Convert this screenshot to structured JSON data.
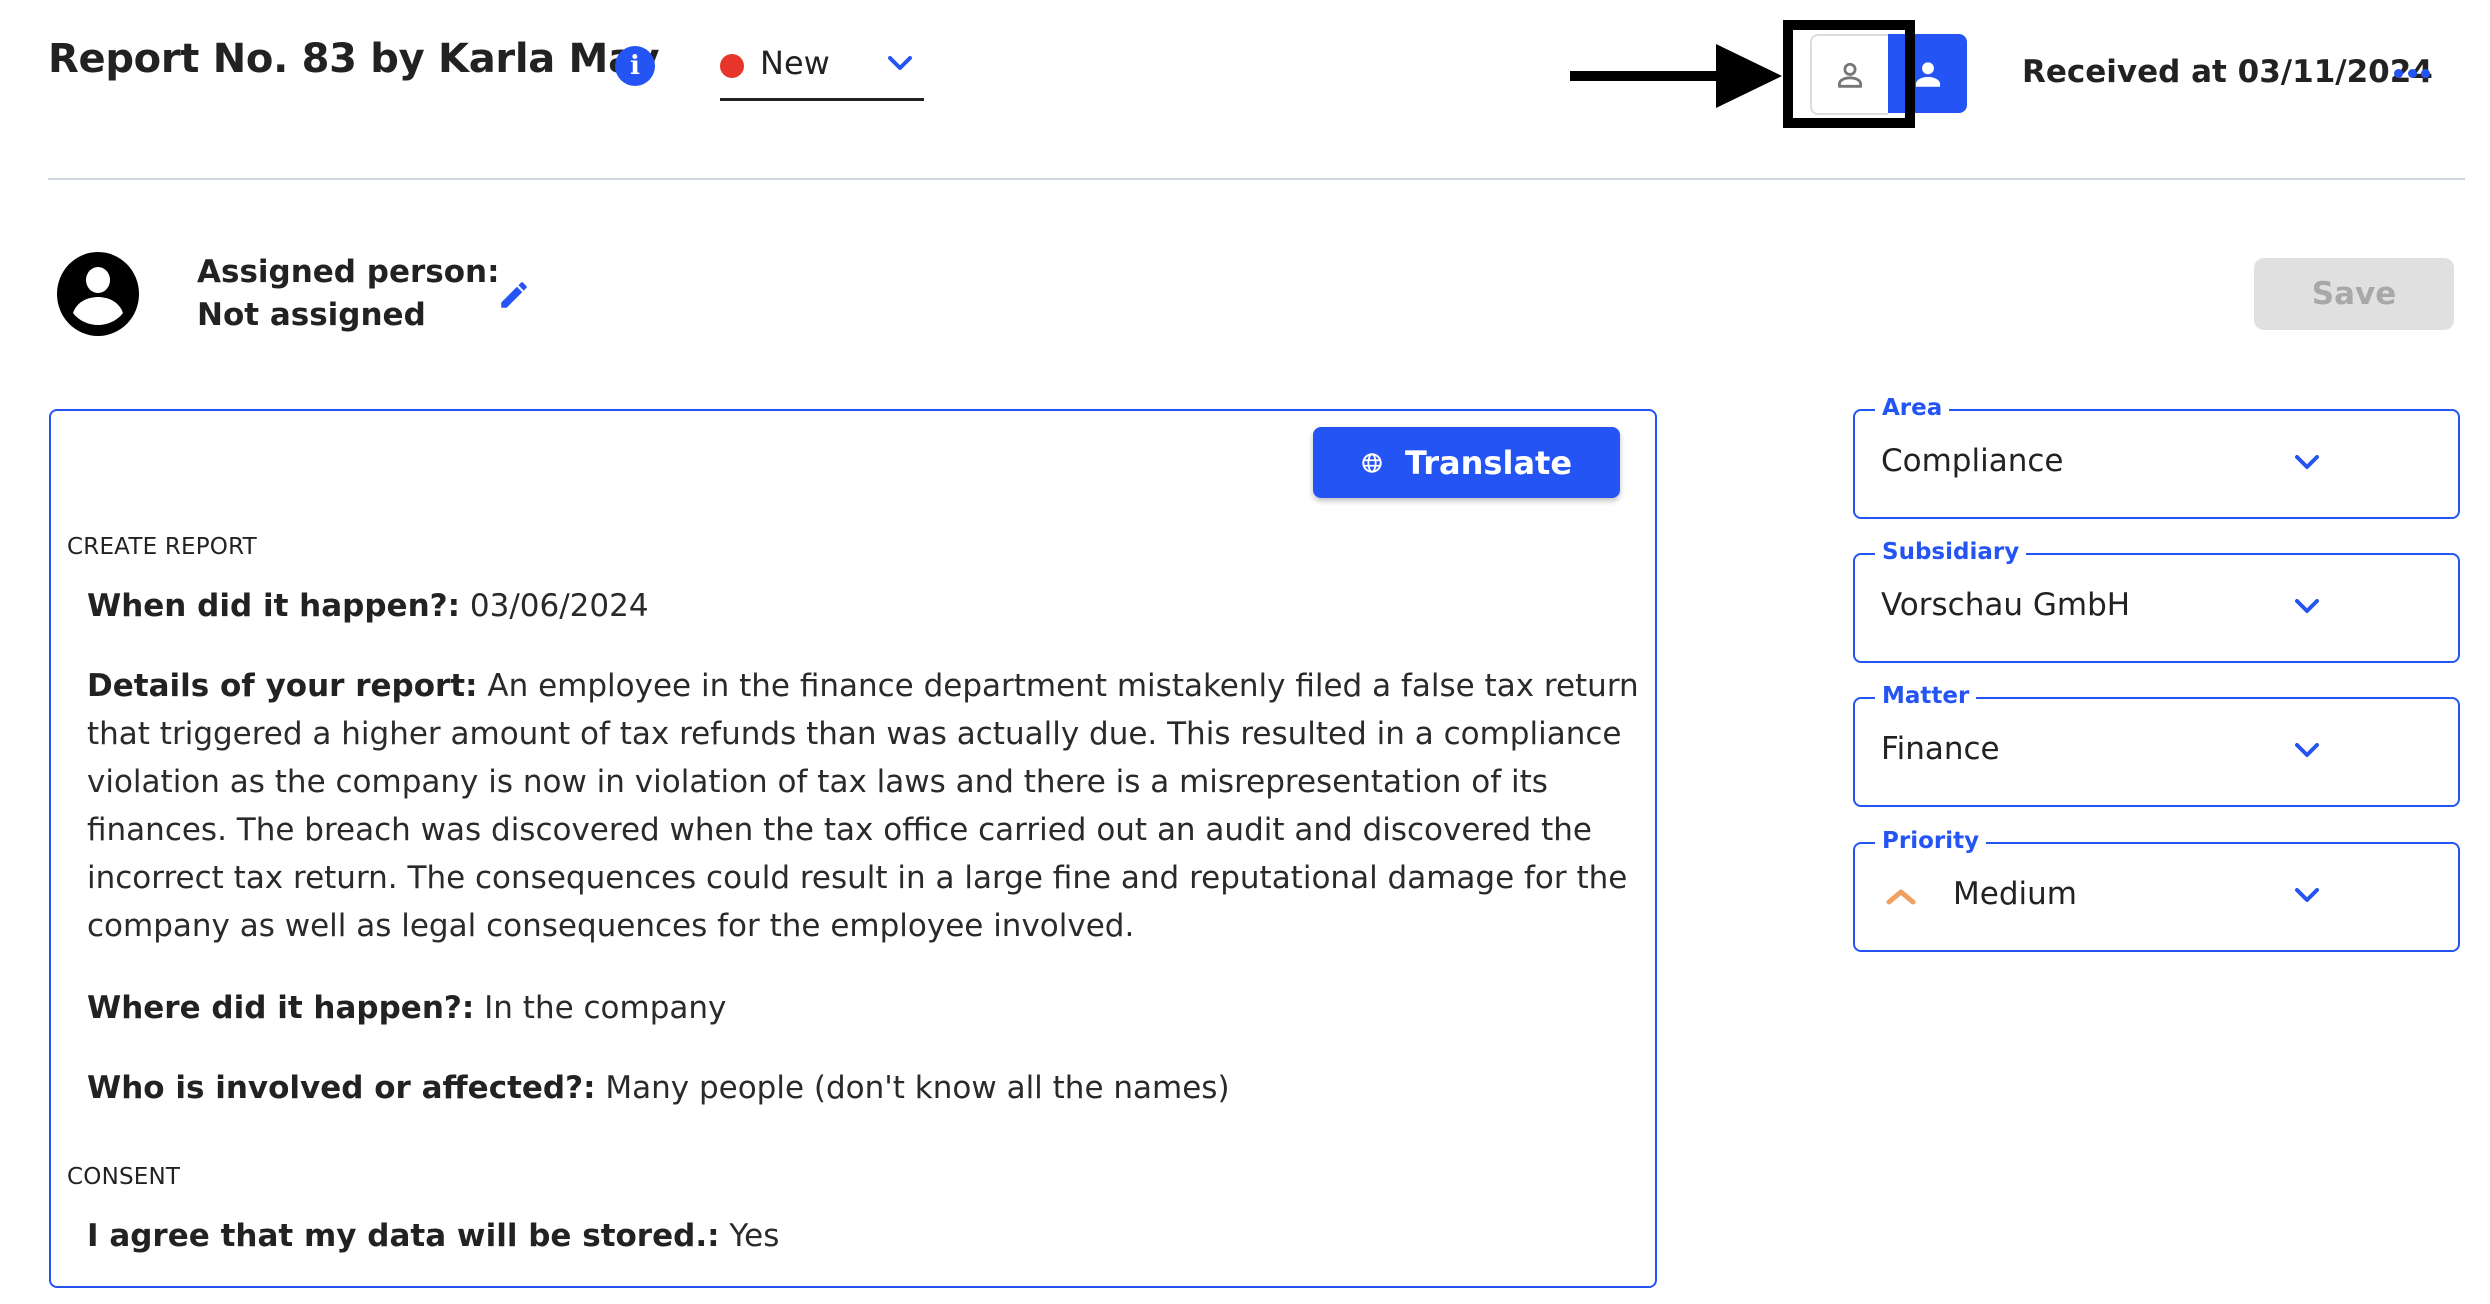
{
  "header": {
    "title": "Report No. 83 by Karla May",
    "info_icon": "info-icon",
    "status": {
      "label": "New",
      "dot_color": "#e8362c"
    },
    "view_toggle": {
      "left_icon": "person-outline-icon",
      "right_icon": "person-filled-icon",
      "active": "right"
    },
    "received": "Received at 03/11/2024",
    "more_icon": "more-horizontal-icon"
  },
  "annotation": {
    "arrow": "arrow-right-icon",
    "highlight": "highlight-box"
  },
  "assignment": {
    "label": "Assigned person:",
    "value": "Not assigned",
    "edit_icon": "pencil-icon"
  },
  "save_label": "Save",
  "report": {
    "translate_label": "Translate",
    "sections": [
      {
        "heading": "CREATE REPORT",
        "items": [
          {
            "q": "When did it happen?:",
            "a": "03/06/2024"
          },
          {
            "q": "Details of your report:",
            "a": "An employee in the finance department mistakenly filed a false tax return that triggered a higher amount of tax refunds than was actually due. This resulted in a compliance violation as the company is now in violation of tax laws and there is a misrepresentation of its finances. The breach was discovered when the tax office carried out an audit and discovered the incorrect tax return. The consequences could result in a large fine and reputational damage for the company as well as legal consequences for the employee involved."
          },
          {
            "q": "Where did it happen?:",
            "a": "In the company"
          },
          {
            "q": "Who is involved or affected?:",
            "a": "Many people (don't know all the names)"
          }
        ]
      },
      {
        "heading": "CONSENT",
        "items": [
          {
            "q": "I agree that my data will be stored.:",
            "a": "Yes"
          }
        ]
      }
    ]
  },
  "fields": [
    {
      "label": "Area",
      "value": "Compliance"
    },
    {
      "label": "Subsidiary",
      "value": "Vorschau GmbH"
    },
    {
      "label": "Matter",
      "value": "Finance"
    },
    {
      "label": "Priority",
      "value": "Medium",
      "icon": "priority-medium-icon",
      "icon_color": "#f0a060"
    }
  ],
  "colors": {
    "accent": "#2455f4",
    "divider": "#cdd5e0",
    "disabled_bg": "#e0e0e0",
    "disabled_text": "#a8a8a8"
  }
}
